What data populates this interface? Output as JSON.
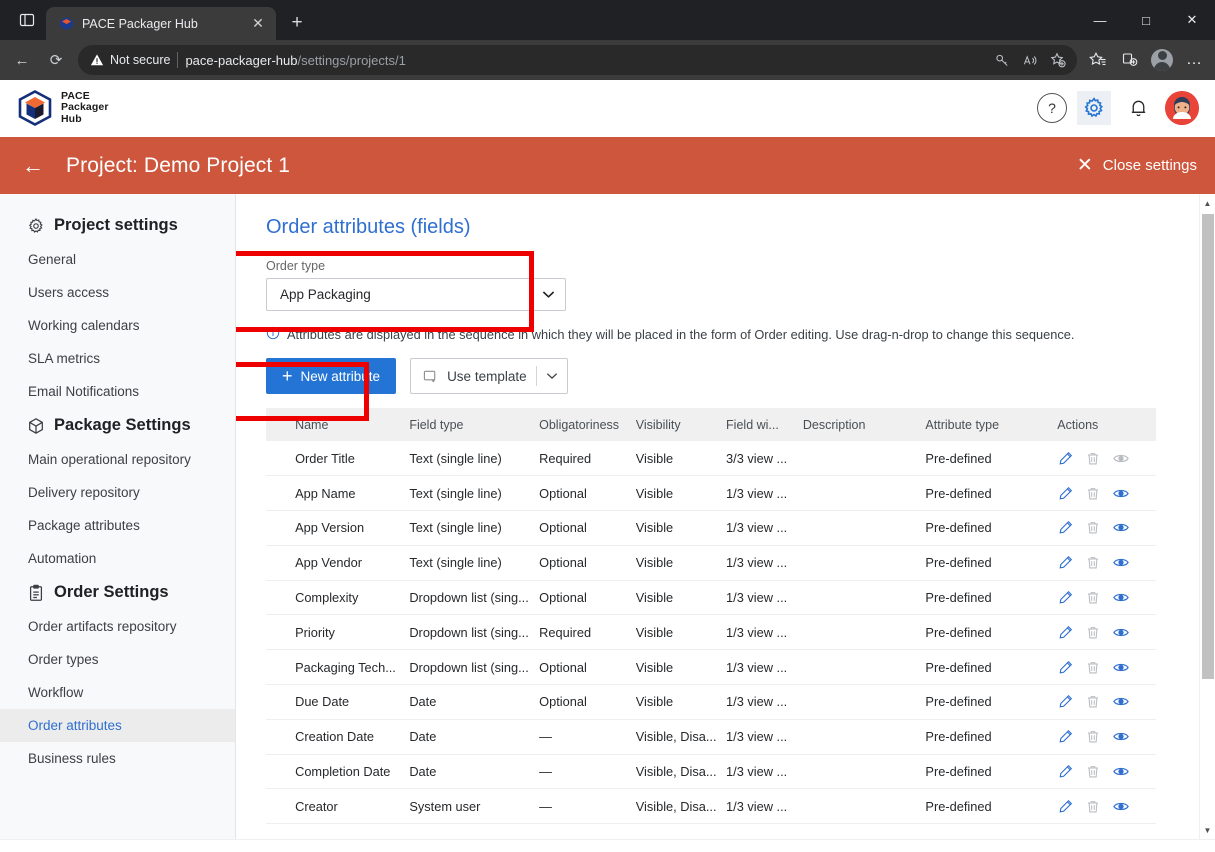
{
  "browser": {
    "tab": {
      "title": "PACE Packager Hub",
      "favicon": "pace-cube-icon",
      "close": "✕"
    },
    "new_tab": "+",
    "window_controls": {
      "minimize": "—",
      "maximize": "□",
      "close": "✕"
    },
    "nav": {
      "back": "←",
      "reload": "⟳"
    },
    "omnibox": {
      "security_label": "Not secure",
      "url_host": "pace-packager-hub",
      "url_path": "/settings/projects/1",
      "icons": [
        "key-icon",
        "read-aloud-icon",
        "add-favorite-icon"
      ]
    },
    "toolbar_icons": [
      "favorites-icon",
      "collections-icon",
      "profile-icon",
      "settings-more-icon"
    ],
    "more": "…"
  },
  "app": {
    "logo": {
      "line1": "PACE",
      "line2": "Packager",
      "line3": "Hub"
    },
    "header_icons": {
      "help": "?",
      "settings": "gear-icon",
      "notifications": "bell-icon",
      "avatar": "user-avatar"
    }
  },
  "project_bar": {
    "back": "←",
    "title": "Project: Demo Project 1",
    "close_settings": "Close settings",
    "close_icon": "✕",
    "bg_color": "#cd563d"
  },
  "sidebar": {
    "groups": [
      {
        "icon": "gear-icon",
        "label": "Project settings",
        "items": [
          {
            "label": "General",
            "selected": false
          },
          {
            "label": "Users access",
            "selected": false
          },
          {
            "label": "Working calendars",
            "selected": false
          },
          {
            "label": "SLA metrics",
            "selected": false
          },
          {
            "label": "Email Notifications",
            "selected": false
          }
        ]
      },
      {
        "icon": "package-icon",
        "label": "Package Settings",
        "items": [
          {
            "label": "Main operational repository",
            "selected": false
          },
          {
            "label": "Delivery repository",
            "selected": false
          },
          {
            "label": "Package attributes",
            "selected": false
          },
          {
            "label": "Automation",
            "selected": false
          }
        ]
      },
      {
        "icon": "clipboard-icon",
        "label": "Order Settings",
        "items": [
          {
            "label": "Order artifacts repository",
            "selected": false
          },
          {
            "label": "Order types",
            "selected": false
          },
          {
            "label": "Workflow",
            "selected": false
          },
          {
            "label": "Order attributes",
            "selected": true
          },
          {
            "label": "Business rules",
            "selected": false
          }
        ]
      }
    ]
  },
  "main": {
    "page_title": "Order attributes (fields)",
    "order_type": {
      "label": "Order type",
      "value": "App Packaging",
      "chevron": "⌄"
    },
    "info_text": "Attributes are displayed in the sequence in which they will be placed in the form of Order editing. Use drag-n-drop to change this sequence.",
    "info_icon": "ⓘ",
    "buttons": {
      "new_attribute": "New attribute",
      "new_attribute_icon": "+",
      "use_template": "Use template",
      "use_template_icon": "template-icon",
      "use_template_chevron": "⌄"
    },
    "table": {
      "columns": [
        "",
        "Name",
        "Field type",
        "Obligatoriness",
        "Visibility",
        "Field wi...",
        "Description",
        "Attribute type",
        "Actions"
      ],
      "rows": [
        {
          "name": "Order Title",
          "field_type": "Text (single line)",
          "obligatoriness": "Required",
          "visibility": "Visible",
          "field_width": "3/3 view ...",
          "description": "",
          "attribute_type": "Pre-defined",
          "eye_enabled": false
        },
        {
          "name": "App Name",
          "field_type": "Text (single line)",
          "obligatoriness": "Optional",
          "visibility": "Visible",
          "field_width": "1/3 view ...",
          "description": "",
          "attribute_type": "Pre-defined",
          "eye_enabled": true
        },
        {
          "name": "App Version",
          "field_type": "Text (single line)",
          "obligatoriness": "Optional",
          "visibility": "Visible",
          "field_width": "1/3 view ...",
          "description": "",
          "attribute_type": "Pre-defined",
          "eye_enabled": true
        },
        {
          "name": "App Vendor",
          "field_type": "Text (single line)",
          "obligatoriness": "Optional",
          "visibility": "Visible",
          "field_width": "1/3 view ...",
          "description": "",
          "attribute_type": "Pre-defined",
          "eye_enabled": true
        },
        {
          "name": "Complexity",
          "field_type": "Dropdown list (sing...",
          "obligatoriness": "Optional",
          "visibility": "Visible",
          "field_width": "1/3 view ...",
          "description": "",
          "attribute_type": "Pre-defined",
          "eye_enabled": true
        },
        {
          "name": "Priority",
          "field_type": "Dropdown list (sing...",
          "obligatoriness": "Required",
          "visibility": "Visible",
          "field_width": "1/3 view ...",
          "description": "",
          "attribute_type": "Pre-defined",
          "eye_enabled": true
        },
        {
          "name": "Packaging Tech...",
          "field_type": "Dropdown list (sing...",
          "obligatoriness": "Optional",
          "visibility": "Visible",
          "field_width": "1/3 view ...",
          "description": "",
          "attribute_type": "Pre-defined",
          "eye_enabled": true
        },
        {
          "name": "Due Date",
          "field_type": "Date",
          "obligatoriness": "Optional",
          "visibility": "Visible",
          "field_width": "1/3 view ...",
          "description": "",
          "attribute_type": "Pre-defined",
          "eye_enabled": true
        },
        {
          "name": "Creation Date",
          "field_type": "Date",
          "obligatoriness": "—",
          "visibility": "Visible, Disa...",
          "field_width": "1/3 view ...",
          "description": "",
          "attribute_type": "Pre-defined",
          "eye_enabled": true
        },
        {
          "name": "Completion Date",
          "field_type": "Date",
          "obligatoriness": "—",
          "visibility": "Visible, Disa...",
          "field_width": "1/3 view ...",
          "description": "",
          "attribute_type": "Pre-defined",
          "eye_enabled": true
        },
        {
          "name": "Creator",
          "field_type": "System user",
          "obligatoriness": "—",
          "visibility": "Visible, Disa...",
          "field_width": "1/3 view ...",
          "description": "",
          "attribute_type": "Pre-defined",
          "eye_enabled": true
        }
      ],
      "action_icons": [
        "edit-pencil-icon",
        "delete-trash-icon",
        "visibility-eye-icon"
      ]
    }
  },
  "annotations": {
    "color": "#ee0000",
    "boxes": [
      "order-type-highlight",
      "new-attribute-highlight"
    ]
  },
  "scrollbar": {
    "up_arrow": "▲",
    "down_arrow": "▼"
  }
}
